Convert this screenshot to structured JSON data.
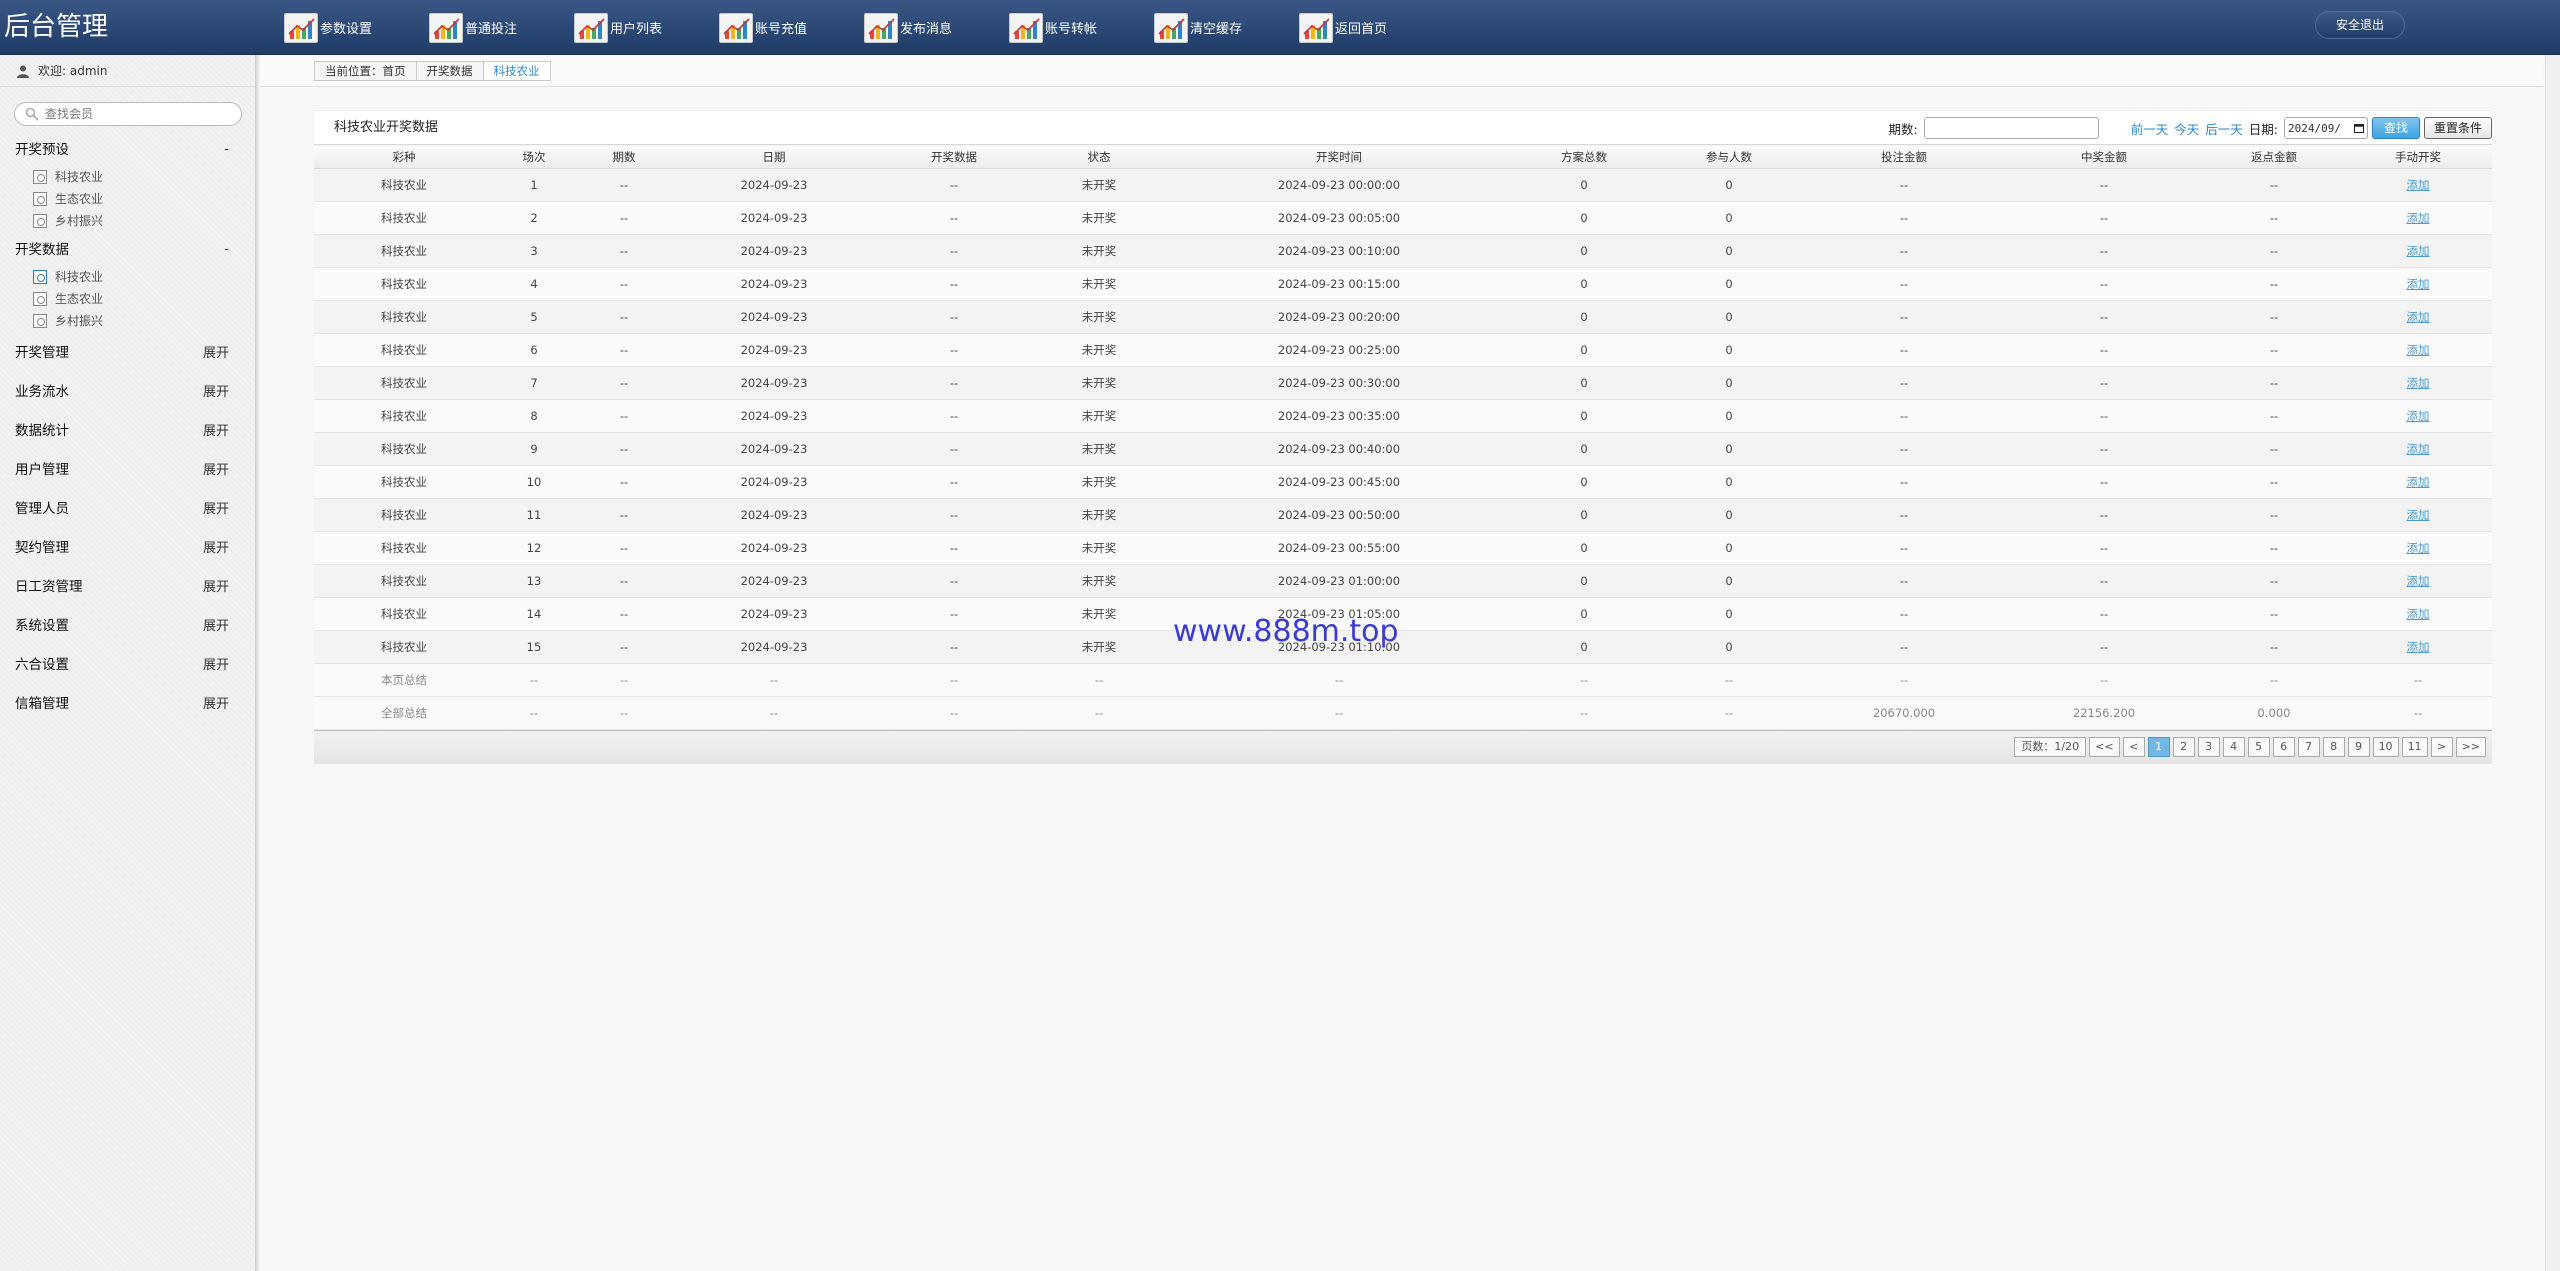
{
  "header": {
    "brand": "后台管理",
    "nav": [
      {
        "label": "参数设置",
        "icon": "chart-icon"
      },
      {
        "label": "普通投注",
        "icon": "chart-icon"
      },
      {
        "label": "用户列表",
        "icon": "chart-icon"
      },
      {
        "label": "账号充值",
        "icon": "chart-icon"
      },
      {
        "label": "发布消息",
        "icon": "chart-icon"
      },
      {
        "label": "账号转帐",
        "icon": "chart-icon"
      },
      {
        "label": "清空缓存",
        "icon": "chart-icon"
      },
      {
        "label": "返回首页",
        "icon": "chart-icon"
      }
    ],
    "logout": "安全退出"
  },
  "sidebar": {
    "welcome": "欢迎: admin",
    "search_placeholder": "查找会员",
    "groups": [
      {
        "title": "开奖预设",
        "toggle": "-",
        "items": [
          "科技农业",
          "生态农业",
          "乡村振兴"
        ]
      },
      {
        "title": "开奖数据",
        "toggle": "-",
        "items": [
          "科技农业",
          "生态农业",
          "乡村振兴"
        ]
      }
    ],
    "collapsed": [
      {
        "title": "开奖管理",
        "toggle": "展开"
      },
      {
        "title": "业务流水",
        "toggle": "展开"
      },
      {
        "title": "数据统计",
        "toggle": "展开"
      },
      {
        "title": "用户管理",
        "toggle": "展开"
      },
      {
        "title": "管理人员",
        "toggle": "展开"
      },
      {
        "title": "契约管理",
        "toggle": "展开"
      },
      {
        "title": "日工资管理",
        "toggle": "展开"
      },
      {
        "title": "系统设置",
        "toggle": "展开"
      },
      {
        "title": "六合设置",
        "toggle": "展开"
      },
      {
        "title": "信箱管理",
        "toggle": "展开"
      }
    ]
  },
  "breadcrumb": [
    "当前位置：首页",
    "开奖数据",
    "科技农业"
  ],
  "panel": {
    "title": "科技农业开奖数据",
    "filter": {
      "period_label": "期数:",
      "prev_day": "前一天",
      "today": "今天",
      "next_day": "后一天",
      "date_label": "日期:",
      "date_value": "2024/09/",
      "find": "查找",
      "reset": "重置条件"
    }
  },
  "table": {
    "columns": [
      "彩种",
      "场次",
      "期数",
      "日期",
      "开奖数据",
      "状态",
      "开奖时间",
      "方案总数",
      "参与人数",
      "投注金额",
      "中奖金额",
      "返点金额",
      "手动开奖"
    ],
    "rows": [
      [
        "科技农业",
        "1",
        "--",
        "2024-09-23",
        "--",
        "未开奖",
        "2024-09-23 00:00:00",
        "0",
        "0",
        "--",
        "--",
        "--",
        "添加"
      ],
      [
        "科技农业",
        "2",
        "--",
        "2024-09-23",
        "--",
        "未开奖",
        "2024-09-23 00:05:00",
        "0",
        "0",
        "--",
        "--",
        "--",
        "添加"
      ],
      [
        "科技农业",
        "3",
        "--",
        "2024-09-23",
        "--",
        "未开奖",
        "2024-09-23 00:10:00",
        "0",
        "0",
        "--",
        "--",
        "--",
        "添加"
      ],
      [
        "科技农业",
        "4",
        "--",
        "2024-09-23",
        "--",
        "未开奖",
        "2024-09-23 00:15:00",
        "0",
        "0",
        "--",
        "--",
        "--",
        "添加"
      ],
      [
        "科技农业",
        "5",
        "--",
        "2024-09-23",
        "--",
        "未开奖",
        "2024-09-23 00:20:00",
        "0",
        "0",
        "--",
        "--",
        "--",
        "添加"
      ],
      [
        "科技农业",
        "6",
        "--",
        "2024-09-23",
        "--",
        "未开奖",
        "2024-09-23 00:25:00",
        "0",
        "0",
        "--",
        "--",
        "--",
        "添加"
      ],
      [
        "科技农业",
        "7",
        "--",
        "2024-09-23",
        "--",
        "未开奖",
        "2024-09-23 00:30:00",
        "0",
        "0",
        "--",
        "--",
        "--",
        "添加"
      ],
      [
        "科技农业",
        "8",
        "--",
        "2024-09-23",
        "--",
        "未开奖",
        "2024-09-23 00:35:00",
        "0",
        "0",
        "--",
        "--",
        "--",
        "添加"
      ],
      [
        "科技农业",
        "9",
        "--",
        "2024-09-23",
        "--",
        "未开奖",
        "2024-09-23 00:40:00",
        "0",
        "0",
        "--",
        "--",
        "--",
        "添加"
      ],
      [
        "科技农业",
        "10",
        "--",
        "2024-09-23",
        "--",
        "未开奖",
        "2024-09-23 00:45:00",
        "0",
        "0",
        "--",
        "--",
        "--",
        "添加"
      ],
      [
        "科技农业",
        "11",
        "--",
        "2024-09-23",
        "--",
        "未开奖",
        "2024-09-23 00:50:00",
        "0",
        "0",
        "--",
        "--",
        "--",
        "添加"
      ],
      [
        "科技农业",
        "12",
        "--",
        "2024-09-23",
        "--",
        "未开奖",
        "2024-09-23 00:55:00",
        "0",
        "0",
        "--",
        "--",
        "--",
        "添加"
      ],
      [
        "科技农业",
        "13",
        "--",
        "2024-09-23",
        "--",
        "未开奖",
        "2024-09-23 01:00:00",
        "0",
        "0",
        "--",
        "--",
        "--",
        "添加"
      ],
      [
        "科技农业",
        "14",
        "--",
        "2024-09-23",
        "--",
        "未开奖",
        "2024-09-23 01:05:00",
        "0",
        "0",
        "--",
        "--",
        "--",
        "添加"
      ],
      [
        "科技农业",
        "15",
        "--",
        "2024-09-23",
        "--",
        "未开奖",
        "2024-09-23 01:10:00",
        "0",
        "0",
        "--",
        "--",
        "--",
        "添加"
      ]
    ],
    "summaries": [
      [
        "本页总结",
        "--",
        "--",
        "--",
        "--",
        "--",
        "--",
        "--",
        "--",
        "--",
        "--",
        "--",
        "--"
      ],
      [
        "全部总结",
        "--",
        "--",
        "--",
        "--",
        "--",
        "--",
        "--",
        "--",
        "20670.000",
        "22156.200",
        "0.000",
        "--"
      ]
    ]
  },
  "pager": {
    "info": "页数：1/20",
    "first": "<<",
    "prev": "<",
    "pages": [
      "1",
      "2",
      "3",
      "4",
      "5",
      "6",
      "7",
      "8",
      "9",
      "10",
      "11"
    ],
    "current": "1",
    "next": ">",
    "last": ">>"
  },
  "watermark": "www.888m.top",
  "colors": {
    "header_bg": "#2a4775",
    "link": "#2f86c7",
    "find_button": "#4aa9e0",
    "current_page": "#72b8e0"
  }
}
